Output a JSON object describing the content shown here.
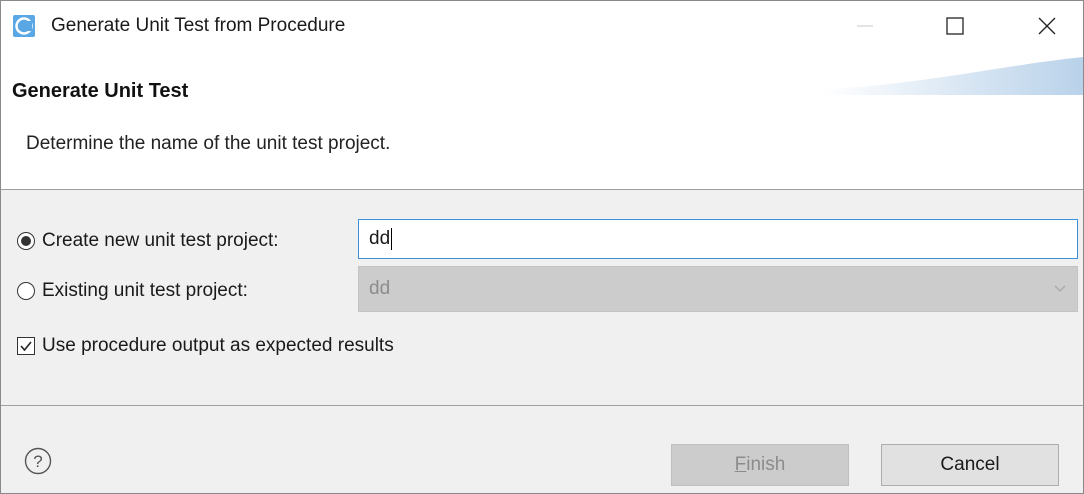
{
  "window": {
    "title": "Generate Unit Test from Procedure"
  },
  "banner": {
    "title": "Generate Unit Test",
    "description": "Determine the name of the unit test project."
  },
  "options": {
    "create_new_label": "Create new unit test project:",
    "create_new_value": "dd",
    "create_new_selected": true,
    "existing_label": "Existing unit test project:",
    "existing_value": "dd",
    "existing_selected": false,
    "use_output_label": "Use procedure output as expected results",
    "use_output_checked": true
  },
  "footer": {
    "finish_mnemonic": "F",
    "finish_rest": "inish",
    "cancel_label": "Cancel"
  },
  "colors": {
    "focus_border": "#3c8fd9",
    "disabled_bg": "#cccccc",
    "dialog_bg": "#f0f0f0"
  },
  "icons": [
    "app-icon",
    "minimize-icon",
    "maximize-icon",
    "close-icon",
    "chevron-down-icon",
    "help-icon",
    "checkmark-icon"
  ]
}
